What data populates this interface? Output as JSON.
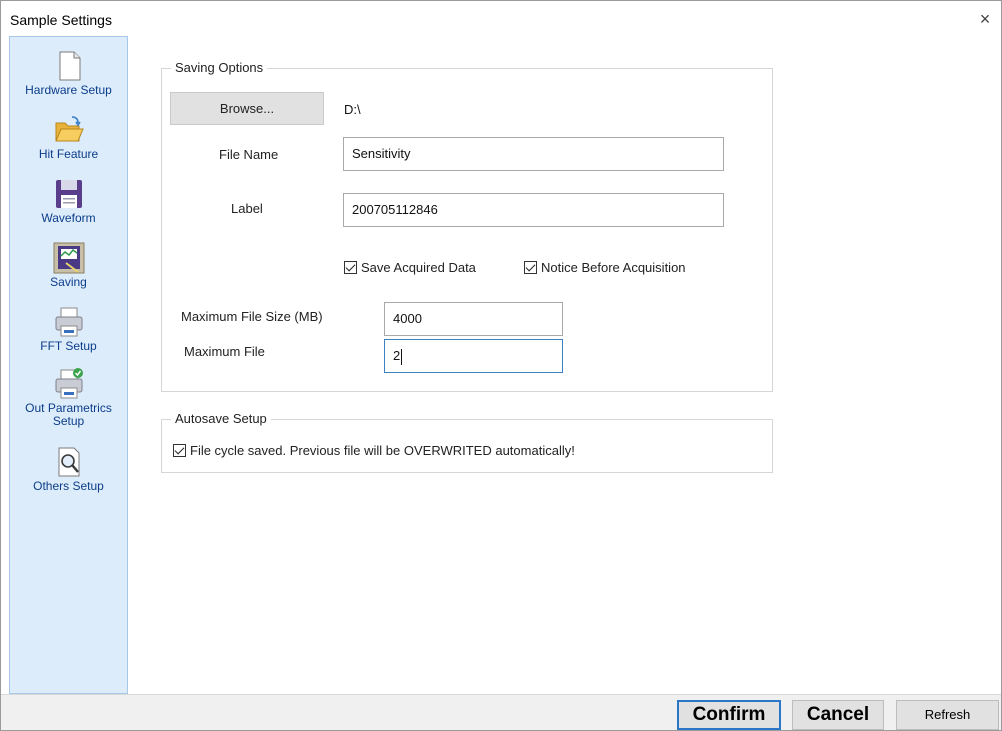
{
  "window": {
    "title": "Sample Settings",
    "close_glyph": "×"
  },
  "sidebar": {
    "items": [
      {
        "label": "Hardware Setup",
        "icon": "document-icon"
      },
      {
        "label": "Hit Feature",
        "icon": "folder-open-icon"
      },
      {
        "label": "Waveform",
        "icon": "floppy-disk-icon"
      },
      {
        "label": "Saving",
        "icon": "saving-chart-icon",
        "selected": true
      },
      {
        "label": "FFT Setup",
        "icon": "printer-icon"
      },
      {
        "label": "Out Parametrics Setup",
        "icon": "printer-check-icon"
      },
      {
        "label": "Others Setup",
        "icon": "magnifier-document-icon"
      }
    ]
  },
  "saving_options": {
    "legend": "Saving Options",
    "browse_label": "Browse...",
    "path": "D:\\",
    "file_name_label": "File Name",
    "file_name_value": "Sensitivity",
    "label_label": "Label",
    "label_value": "200705112846",
    "save_acquired_label": "Save Acquired Data",
    "save_acquired_checked": true,
    "notice_before_label": "Notice Before Acquisition",
    "notice_before_checked": true,
    "max_file_size_label": "Maximum File Size (MB)",
    "max_file_size_value": "4000",
    "max_file_label": "Maximum File",
    "max_file_value": "2"
  },
  "autosave": {
    "legend": "Autosave Setup",
    "cycle_label": "File cycle saved. Previous file will be OVERWRITED automatically!",
    "cycle_checked": true
  },
  "footer": {
    "confirm_label": "Confirm",
    "cancel_label": "Cancel",
    "refresh_label": "Refresh"
  },
  "colors": {
    "sidebar_bg": "#ddecfb",
    "nav_label": "#0b3d8a",
    "focus_border": "#3b82c4"
  }
}
